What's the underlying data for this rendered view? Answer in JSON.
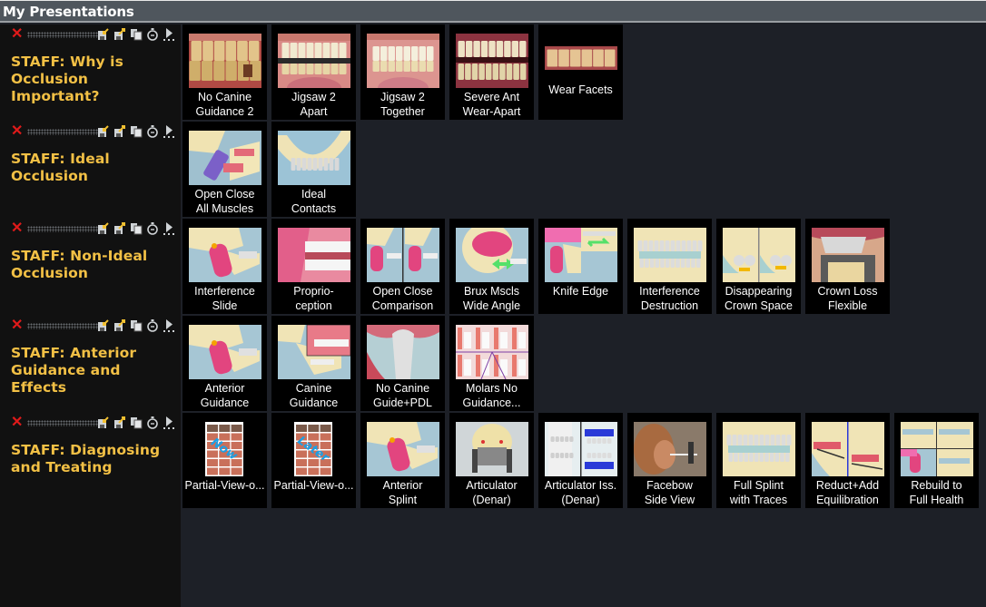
{
  "header": {
    "title": "My Presentations"
  },
  "toolbar_icons": [
    "delete-icon",
    "import-icon",
    "export-icon",
    "copy-icon",
    "timer-icon",
    "play-icon"
  ],
  "colors": {
    "title": "#f2c045",
    "header_bg": "#4f565d",
    "panel_bg": "#111111",
    "tile_bg": "#000000",
    "delete": "#e01a1a"
  },
  "presentations": [
    {
      "title": "STAFF: Why is Occlusion Important?",
      "slides": [
        {
          "label": [
            "No Canine",
            "Guidance 2"
          ],
          "thumb": "photo-teeth-side"
        },
        {
          "label": [
            "Jigsaw 2",
            "Apart"
          ],
          "thumb": "photo-teeth-apart"
        },
        {
          "label": [
            "Jigsaw 2",
            "Together"
          ],
          "thumb": "photo-teeth-together"
        },
        {
          "label": [
            "Severe Ant",
            "Wear-Apart"
          ],
          "thumb": "photo-teeth-wear"
        },
        {
          "label": [
            "Wear Facets"
          ],
          "thumb": "photo-molars"
        }
      ]
    },
    {
      "title": "STAFF: Ideal Occlusion",
      "slides": [
        {
          "label": [
            "Open Close",
            "All Muscles"
          ],
          "thumb": "render-jaw-muscles"
        },
        {
          "label": [
            "Ideal",
            "Contacts"
          ],
          "thumb": "render-lower-arch"
        }
      ]
    },
    {
      "title": "STAFF: Non-Ideal Occlusion",
      "slides": [
        {
          "label": [
            "Interference",
            "Slide"
          ],
          "thumb": "render-skull-side"
        },
        {
          "label": [
            "Proprio-",
            "ception"
          ],
          "thumb": "render-proprioception"
        },
        {
          "label": [
            "Open Close",
            "Comparison"
          ],
          "thumb": "render-split-skull"
        },
        {
          "label": [
            "Brux Mscls",
            "Wide Angle"
          ],
          "thumb": "render-skull-brux"
        },
        {
          "label": [
            "Knife Edge"
          ],
          "thumb": "render-knife-edge"
        },
        {
          "label": [
            "Interference",
            "Destruction"
          ],
          "thumb": "render-front-teeth"
        },
        {
          "label": [
            "Disappearing",
            "Crown Space"
          ],
          "thumb": "render-crown-space"
        },
        {
          "label": [
            "Crown Loss",
            "Flexible"
          ],
          "thumb": "render-crown-loss"
        }
      ]
    },
    {
      "title": "STAFF: Anterior Guidance and Effects",
      "slides": [
        {
          "label": [
            "Anterior",
            "Guidance"
          ],
          "thumb": "render-skull-side"
        },
        {
          "label": [
            "Canine",
            "Guidance"
          ],
          "thumb": "render-canine-guidance"
        },
        {
          "label": [
            "No Canine",
            "Guide+PDL"
          ],
          "thumb": "render-pdl"
        },
        {
          "label": [
            "Molars No",
            "Guidance..."
          ],
          "thumb": "render-molar-grid"
        }
      ]
    },
    {
      "title": "STAFF: Diagnosing and Treating",
      "slides": [
        {
          "label": [
            "Partial-View-o..."
          ],
          "thumb": "doc-now",
          "overlay": "Now"
        },
        {
          "label": [
            "Partial-View-o..."
          ],
          "thumb": "doc-later",
          "overlay": "Later"
        },
        {
          "label": [
            "Anterior",
            "Splint"
          ],
          "thumb": "render-skull-side"
        },
        {
          "label": [
            "Articulator",
            "(Denar)"
          ],
          "thumb": "render-articulator"
        },
        {
          "label": [
            "Articulator Iss.",
            "(Denar)"
          ],
          "thumb": "render-articulator-issue"
        },
        {
          "label": [
            "Facebow",
            "Side View"
          ],
          "thumb": "photo-facebow"
        },
        {
          "label": [
            "Full Splint",
            "with Traces"
          ],
          "thumb": "render-front-teeth"
        },
        {
          "label": [
            "Reduct+Add",
            "Equilibration"
          ],
          "thumb": "render-equilibration"
        },
        {
          "label": [
            "Rebuild to",
            "Full Health"
          ],
          "thumb": "render-rebuild"
        }
      ]
    }
  ]
}
